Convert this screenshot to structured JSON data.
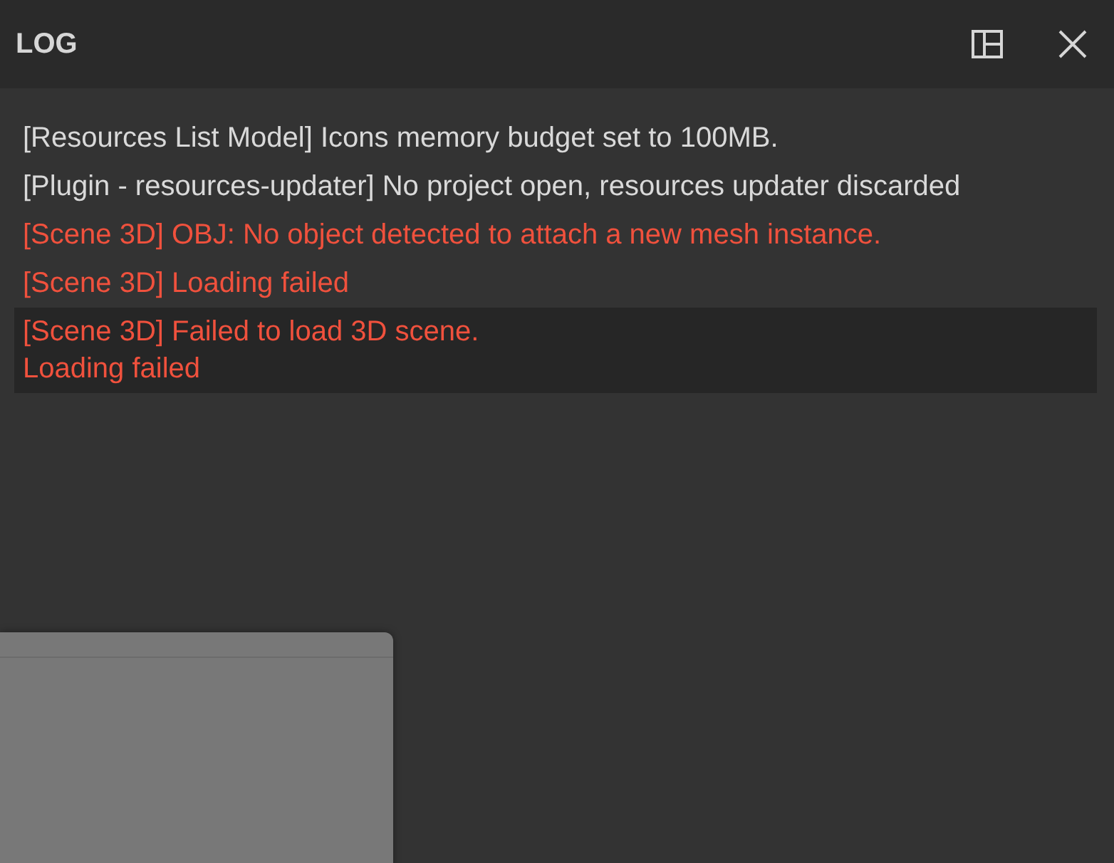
{
  "panel": {
    "title": "LOG"
  },
  "entries": [
    {
      "kind": "info",
      "text": "[Resources List Model] Icons memory budget set to 100MB.",
      "selected": false
    },
    {
      "kind": "info",
      "text": "[Plugin - resources-updater] No project open, resources updater discarded",
      "selected": false
    },
    {
      "kind": "error",
      "text": "[Scene 3D] OBJ: No object detected to attach a new mesh instance.",
      "selected": false
    },
    {
      "kind": "error",
      "text": "[Scene 3D] Loading failed",
      "selected": false
    },
    {
      "kind": "error",
      "text": "[Scene 3D] Failed to load 3D scene.\nLoading failed",
      "selected": true
    }
  ]
}
